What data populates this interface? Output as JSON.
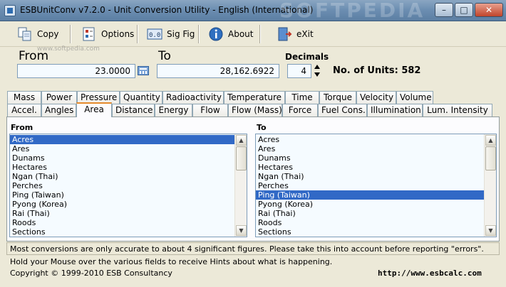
{
  "window": {
    "title": "ESBUnitConv v7.2.0 - Unit Conversion Utility - English (International)",
    "watermark": "SOFTPEDIA",
    "controls": {
      "minimize": "–",
      "maximize": "□",
      "close": "✕"
    }
  },
  "toolbar": {
    "copy": "Copy",
    "options": "Options",
    "sigfig": "Sig Fig",
    "about": "About",
    "exit": "eXit",
    "watermark_small": "www.softpedia.com"
  },
  "conversion": {
    "from_label": "From",
    "to_label": "To",
    "from_value": "23.0000",
    "to_value": "28,162.6922",
    "decimals_label": "Decimals",
    "decimals_value": "4",
    "units_count_text": "No. of Units: 582"
  },
  "tabs_row1": [
    "Mass",
    "Power",
    "Pressure",
    "Quantity",
    "Radioactivity",
    "Temperature",
    "Time",
    "Torque",
    "Velocity",
    "Volume"
  ],
  "tabs_row2": [
    "Accel.",
    "Angles",
    "Area",
    "Distance",
    "Energy",
    "Flow",
    "Flow (Mass)",
    "Force",
    "Fuel Cons.",
    "Illumination",
    "Lum. Intensity"
  ],
  "active_tab": "Area",
  "lists": {
    "from_title": "From",
    "to_title": "To",
    "from_items": [
      "Acres",
      "Ares",
      "Dunams",
      "Hectares",
      "Ngan (Thai)",
      "Perches",
      "Ping (Taiwan)",
      "Pyong (Korea)",
      "Rai (Thai)",
      "Roods",
      "Sections"
    ],
    "to_items": [
      "Acres",
      "Ares",
      "Dunams",
      "Hectares",
      "Ngan (Thai)",
      "Perches",
      "Ping (Taiwan)",
      "Pyong (Korea)",
      "Rai (Thai)",
      "Roods",
      "Sections"
    ],
    "from_selected": "Acres",
    "to_selected": "Ping (Taiwan)"
  },
  "status": {
    "line1": "Most conversions are only accurate to about 4 significant figures. Please take this into account before reporting \"errors\".",
    "line2": "Hold your Mouse over the various fields to receive Hints about what is happening.",
    "copyright": "Copyright © 1999-2010 ESB Consultancy",
    "url": "http://www.esbcalc.com"
  },
  "colors": {
    "accent": "#e68b2c",
    "selection": "#3169c6",
    "titlebar": "#6d8fb2"
  }
}
